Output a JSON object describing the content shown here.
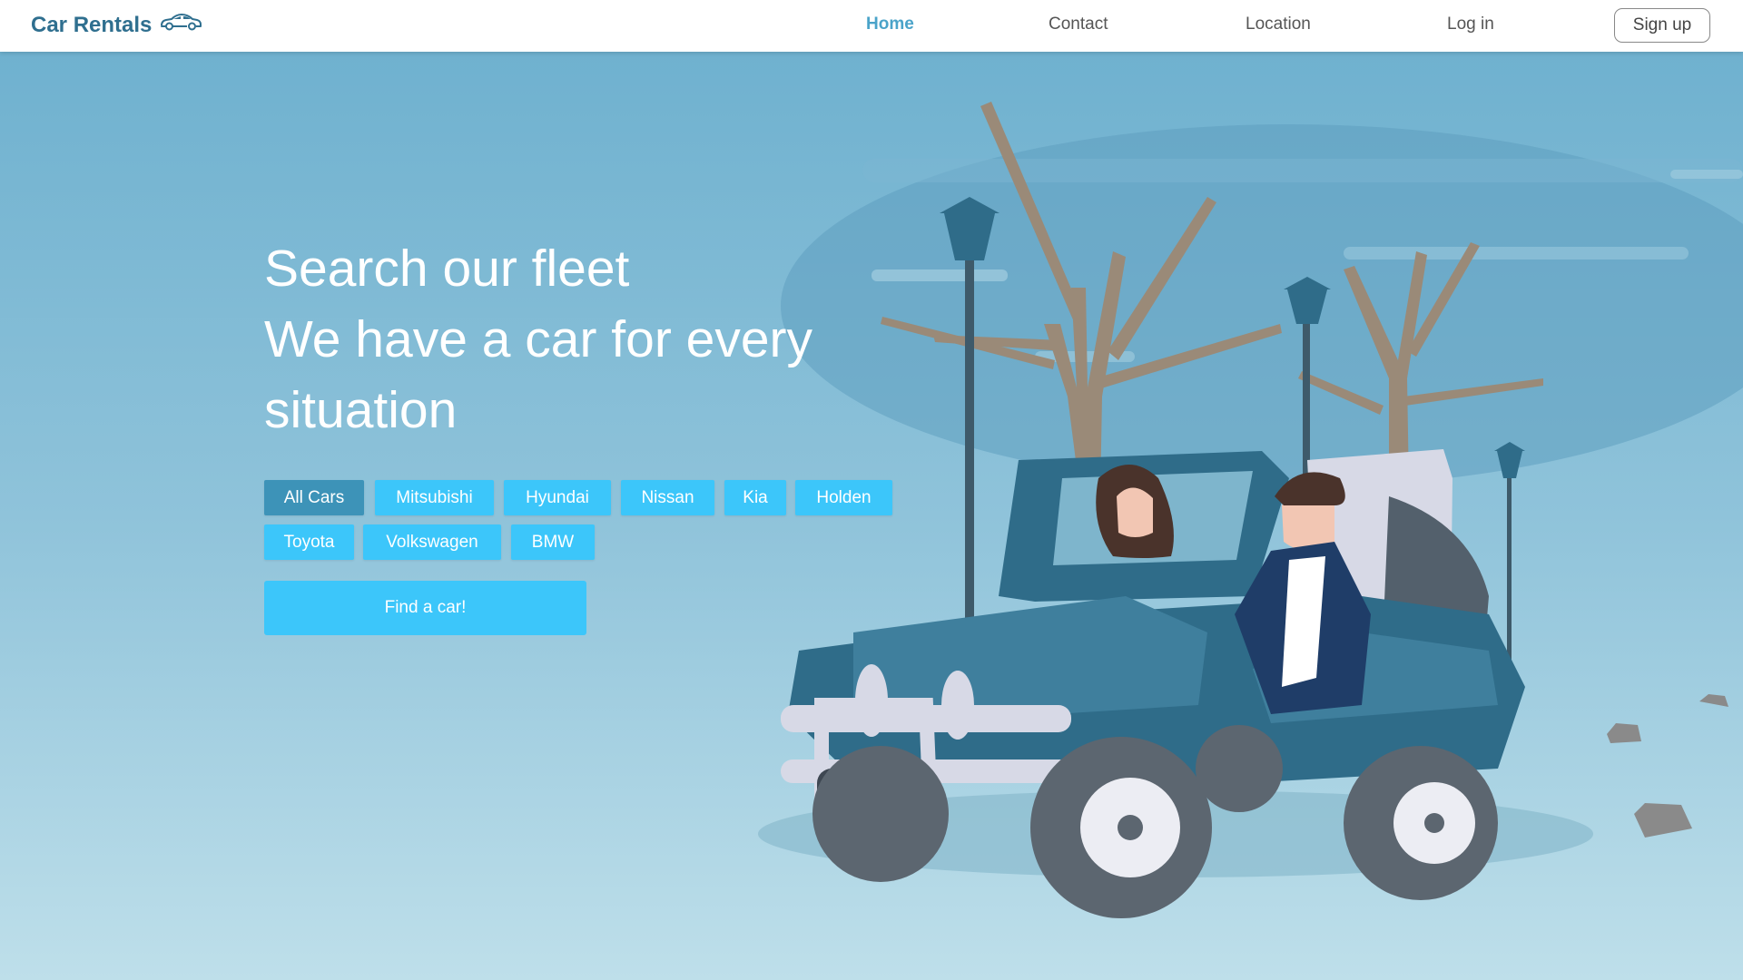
{
  "brand": {
    "name": "Car Rentals",
    "icon": "car-outline-icon",
    "color": "#2f6f8f"
  },
  "nav": {
    "items": [
      {
        "label": "Home",
        "active": true
      },
      {
        "label": "Contact",
        "active": false
      },
      {
        "label": "Location",
        "active": false
      },
      {
        "label": "Log in",
        "active": false
      }
    ],
    "signup_label": "Sign up",
    "active_color": "#4aa3c9"
  },
  "hero": {
    "headline": [
      "Search our fleet",
      "We have a car for every",
      "situation"
    ],
    "filters": [
      "All Cars",
      "Mitsubishi",
      "Hyundai",
      "Nissan",
      "Kia",
      "Holden",
      "Toyota",
      "Volkswagen",
      "BMW"
    ],
    "active_filter": "All Cars",
    "cta_label": "Find a car!",
    "illustration": "jeep-with-couple-illustration"
  },
  "colors": {
    "accent": "#3cc6fa",
    "accent_active": "#3d93b8",
    "sky_top": "#6fb1cf",
    "sky_bottom": "#bedfea",
    "jeep": "#2f6c89"
  }
}
